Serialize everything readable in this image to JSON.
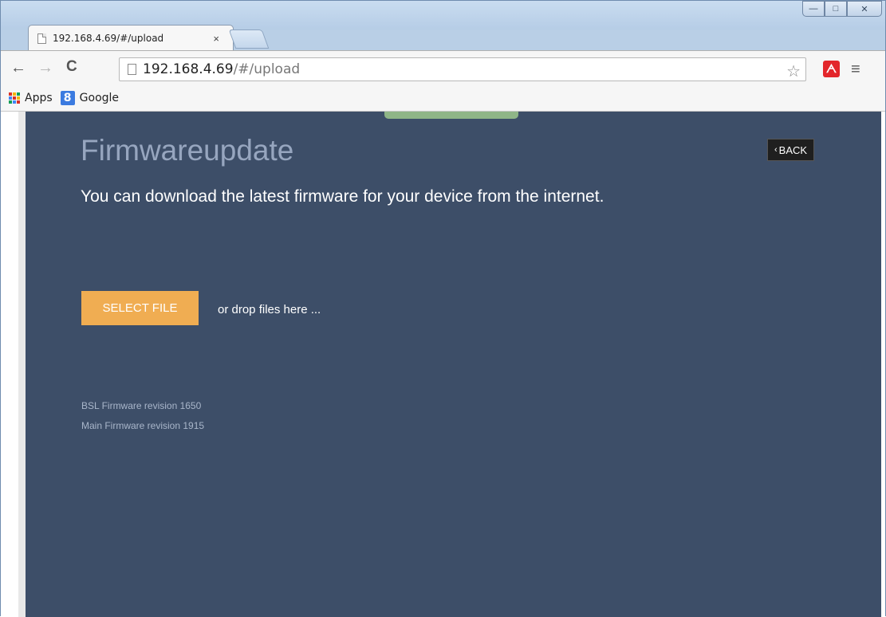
{
  "browser": {
    "tab_title": "192.168.4.69/#/upload",
    "tab_close": "×",
    "url_host": "192.168.4.69",
    "url_path": "/#/upload",
    "window_controls": {
      "minimize": "—",
      "maximize": "□",
      "close": "✕"
    },
    "nav": {
      "back": "←",
      "forward": "→",
      "reload": "C"
    },
    "bookmarks": [
      {
        "label": "Apps",
        "icon": "apps-grid-icon"
      },
      {
        "label": "Google",
        "icon": "google-icon"
      }
    ],
    "extension_label": "ᗅ",
    "menu_glyph": "≡",
    "star_glyph": "☆"
  },
  "page": {
    "title": "Firmwareupdate",
    "back_label": "BACK",
    "back_chevron": "‹",
    "subtitle": "You can download the latest firmware for your device from the internet.",
    "select_file_label": "SELECT FILE",
    "drop_text": "or drop files here ...",
    "bsl_revision": "BSL Firmware revision 1650",
    "main_revision": "Main Firmware revision 1915"
  },
  "colors": {
    "page_bg": "#3d4e68",
    "title": "#97a6bf",
    "select_button": "#f0ad52",
    "progress_tab": "#8fb587",
    "back_button": "#1f1f1f"
  }
}
